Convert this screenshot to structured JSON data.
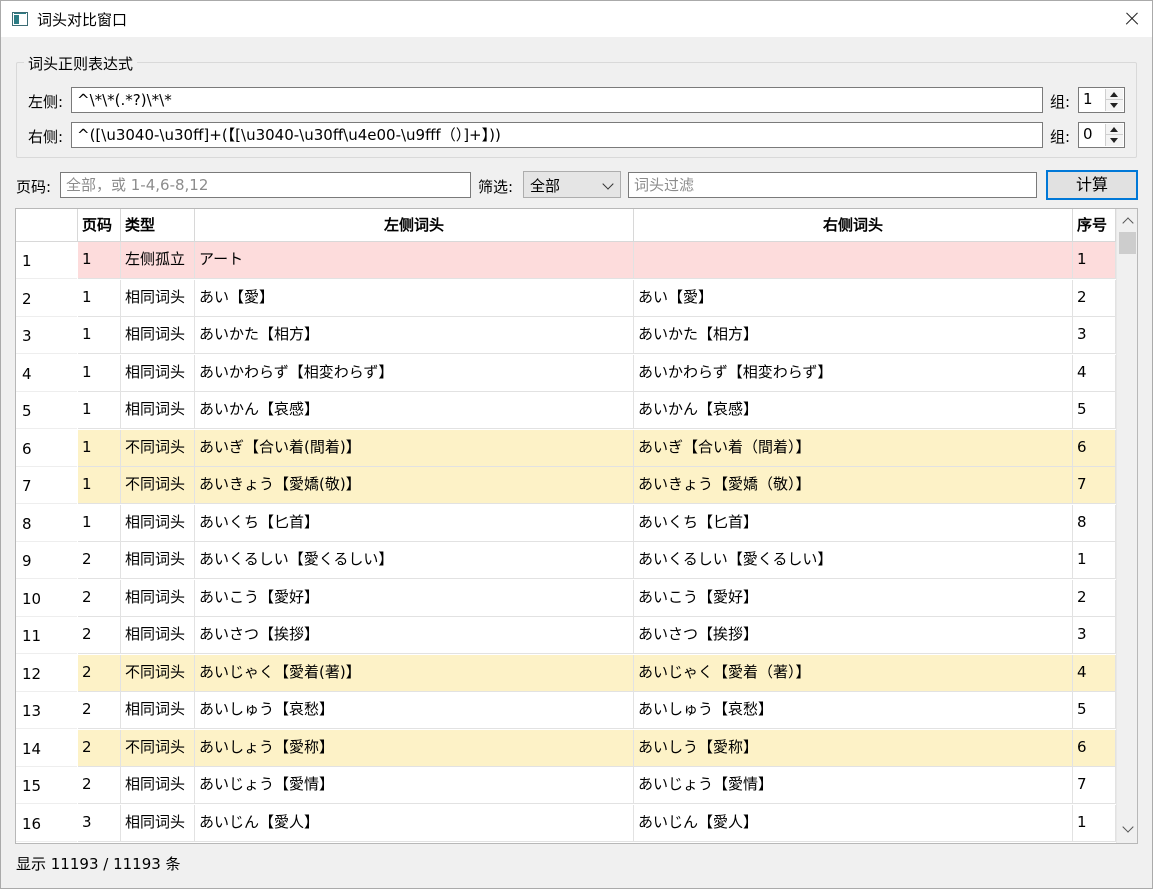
{
  "window": {
    "title": "词头对比窗口",
    "close_icon": "close-icon"
  },
  "regex_group": {
    "title": "词头正则表达式",
    "left_label": "左侧:",
    "left_value": "^\\*\\*(.*?)\\*\\*",
    "left_group_label": "组:",
    "left_group_value": "1",
    "right_label": "右侧:",
    "right_value": "^([\\u3040-\\u30ff]+(【[\\u3040-\\u30ff\\u4e00-\\u9fff（）]+】))",
    "right_group_label": "组:",
    "right_group_value": "0"
  },
  "filters": {
    "page_label": "页码:",
    "page_placeholder": "全部，或 1-4,6-8,12",
    "filter_label": "筛选:",
    "filter_selected": "全部",
    "headword_placeholder": "词头过滤",
    "compute_button": "计算"
  },
  "table": {
    "headers": {
      "page": "页码",
      "type": "类型",
      "left": "左侧词头",
      "right": "右侧词头",
      "index": "序号"
    },
    "rows": [
      {
        "num": "1",
        "page": "1",
        "type": "左侧孤立",
        "left": "アート",
        "right": "",
        "index": "1",
        "status": "left-only"
      },
      {
        "num": "2",
        "page": "1",
        "type": "相同词头",
        "left": "あい【愛】",
        "right": "あい【愛】",
        "index": "2",
        "status": "same"
      },
      {
        "num": "3",
        "page": "1",
        "type": "相同词头",
        "left": "あいかた【相方】",
        "right": "あいかた【相方】",
        "index": "3",
        "status": "same"
      },
      {
        "num": "4",
        "page": "1",
        "type": "相同词头",
        "left": "あいかわらず【相変わらず】",
        "right": "あいかわらず【相変わらず】",
        "index": "4",
        "status": "same"
      },
      {
        "num": "5",
        "page": "1",
        "type": "相同词头",
        "left": "あいかん【哀感】",
        "right": "あいかん【哀感】",
        "index": "5",
        "status": "same"
      },
      {
        "num": "6",
        "page": "1",
        "type": "不同词头",
        "left": "あいぎ【合い着(間着)】",
        "right": "あいぎ【合い着（間着）】",
        "index": "6",
        "status": "diff"
      },
      {
        "num": "7",
        "page": "1",
        "type": "不同词头",
        "left": "あいきょう【愛嬌(敬)】",
        "right": "あいきょう【愛嬌（敬）】",
        "index": "7",
        "status": "diff"
      },
      {
        "num": "8",
        "page": "1",
        "type": "相同词头",
        "left": "あいくち【匕首】",
        "right": "あいくち【匕首】",
        "index": "8",
        "status": "same"
      },
      {
        "num": "9",
        "page": "2",
        "type": "相同词头",
        "left": "あいくるしい【愛くるしい】",
        "right": "あいくるしい【愛くるしい】",
        "index": "1",
        "status": "same"
      },
      {
        "num": "10",
        "page": "2",
        "type": "相同词头",
        "left": "あいこう【愛好】",
        "right": "あいこう【愛好】",
        "index": "2",
        "status": "same"
      },
      {
        "num": "11",
        "page": "2",
        "type": "相同词头",
        "left": "あいさつ【挨拶】",
        "right": "あいさつ【挨拶】",
        "index": "3",
        "status": "same"
      },
      {
        "num": "12",
        "page": "2",
        "type": "不同词头",
        "left": "あいじゃく【愛着(著)】",
        "right": "あいじゃく【愛着（著）】",
        "index": "4",
        "status": "diff"
      },
      {
        "num": "13",
        "page": "2",
        "type": "相同词头",
        "left": "あいしゅう【哀愁】",
        "right": "あいしゅう【哀愁】",
        "index": "5",
        "status": "same"
      },
      {
        "num": "14",
        "page": "2",
        "type": "不同词头",
        "left": "あいしょう【愛称】",
        "right": "あいしう【愛称】",
        "index": "6",
        "status": "diff"
      },
      {
        "num": "15",
        "page": "2",
        "type": "相同词头",
        "left": "あいじょう【愛情】",
        "right": "あいじょう【愛情】",
        "index": "7",
        "status": "same"
      },
      {
        "num": "16",
        "page": "3",
        "type": "相同词头",
        "left": "あいじん【愛人】",
        "right": "あいじん【愛人】",
        "index": "1",
        "status": "same"
      }
    ]
  },
  "colors": {
    "left-only": "#fddcdc",
    "diff": "#fdf2c7",
    "same": "#ffffff"
  },
  "status_bar": "显示 11193 / 11193 条"
}
